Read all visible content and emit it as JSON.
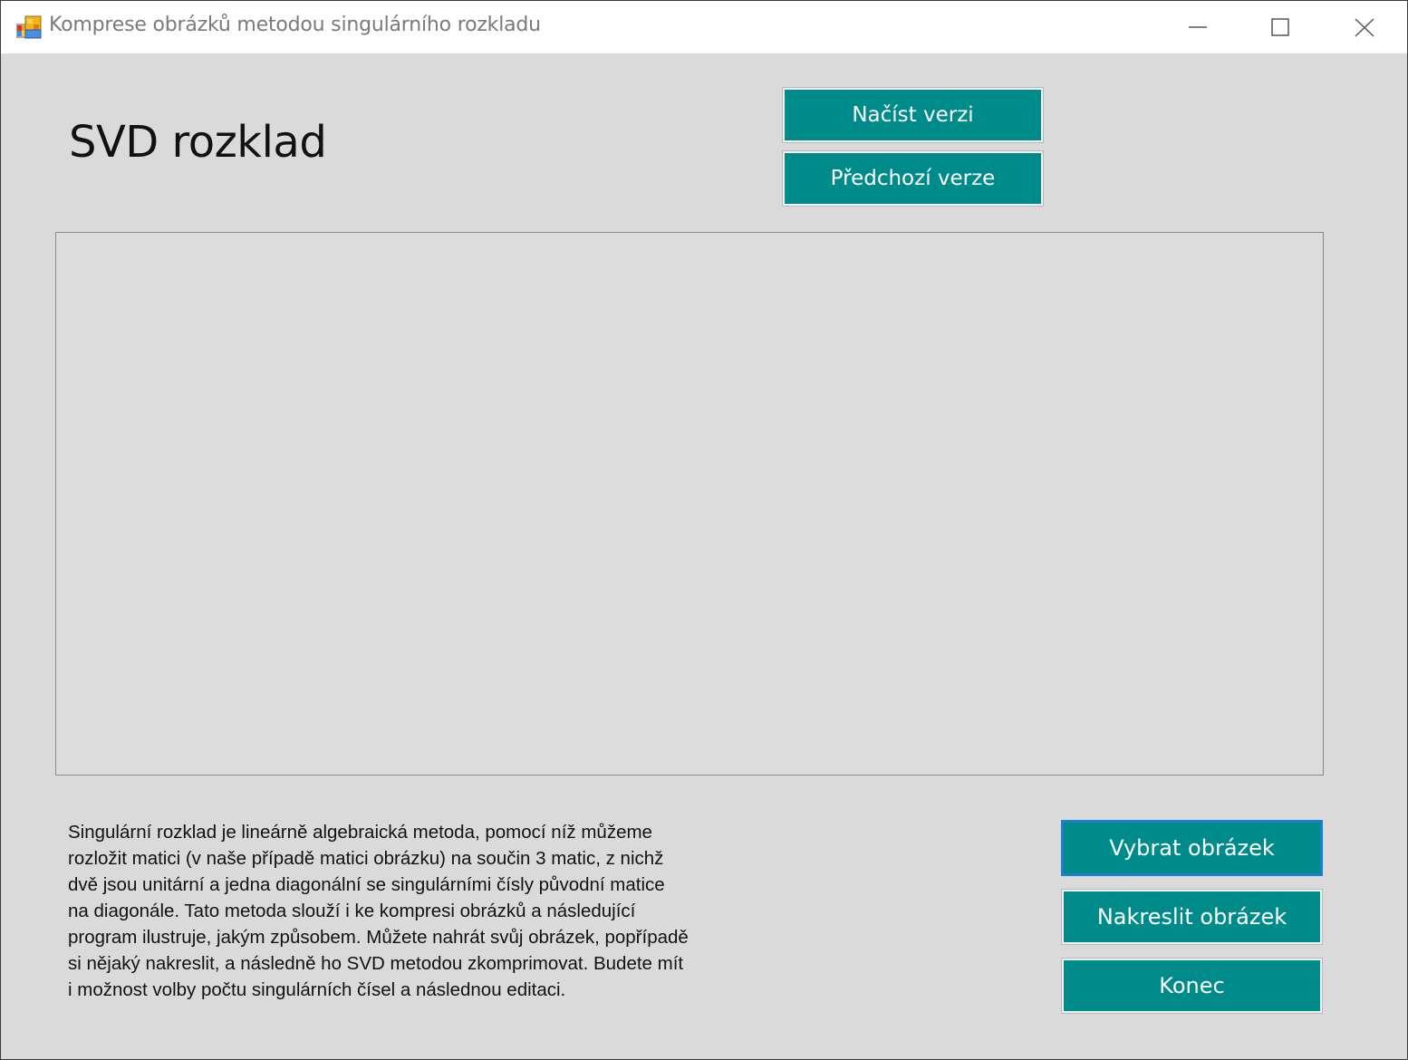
{
  "window": {
    "title": "Komprese obrázků metodou singulárního rozkladu",
    "icon": "app-windows-icon",
    "controls": {
      "minimize_icon": "minimize-icon",
      "maximize_icon": "maximize-icon",
      "close_icon": "close-icon"
    }
  },
  "main": {
    "heading": "SVD rozklad",
    "buttons": {
      "load_version": "Načíst verzi",
      "previous_version": "Předchozí verze",
      "choose_image": "Vybrat obrázek",
      "draw_image": "Nakreslit obrázek",
      "end": "Konec"
    },
    "description_lines": [
      "Singulární rozklad je lineárně algebraická metoda, pomocí níž můžeme",
      "rozložit matici (v naše případě matici obrázku) na součin 3 matic, z nichž",
      "dvě jsou unitární a jedna diagonální se singulárními čísly původní  matice",
      "na diagonále. Tato metoda slouží i ke kompresi obrázků a následující",
      "program ilustruje, jakým způsobem. Můžete nahrát svůj obrázek, popřípadě",
      "si nějaký nakreslit, a následně ho SVD metodou  zkomprimovat. Budete mít",
      "i možnost volby počtu singulárních čísel a následnou editaci."
    ]
  },
  "colors": {
    "button_bg": "#008b8b",
    "button_text": "#ffffff",
    "window_bg": "#dadada",
    "focus_border": "#1a7fd0"
  }
}
